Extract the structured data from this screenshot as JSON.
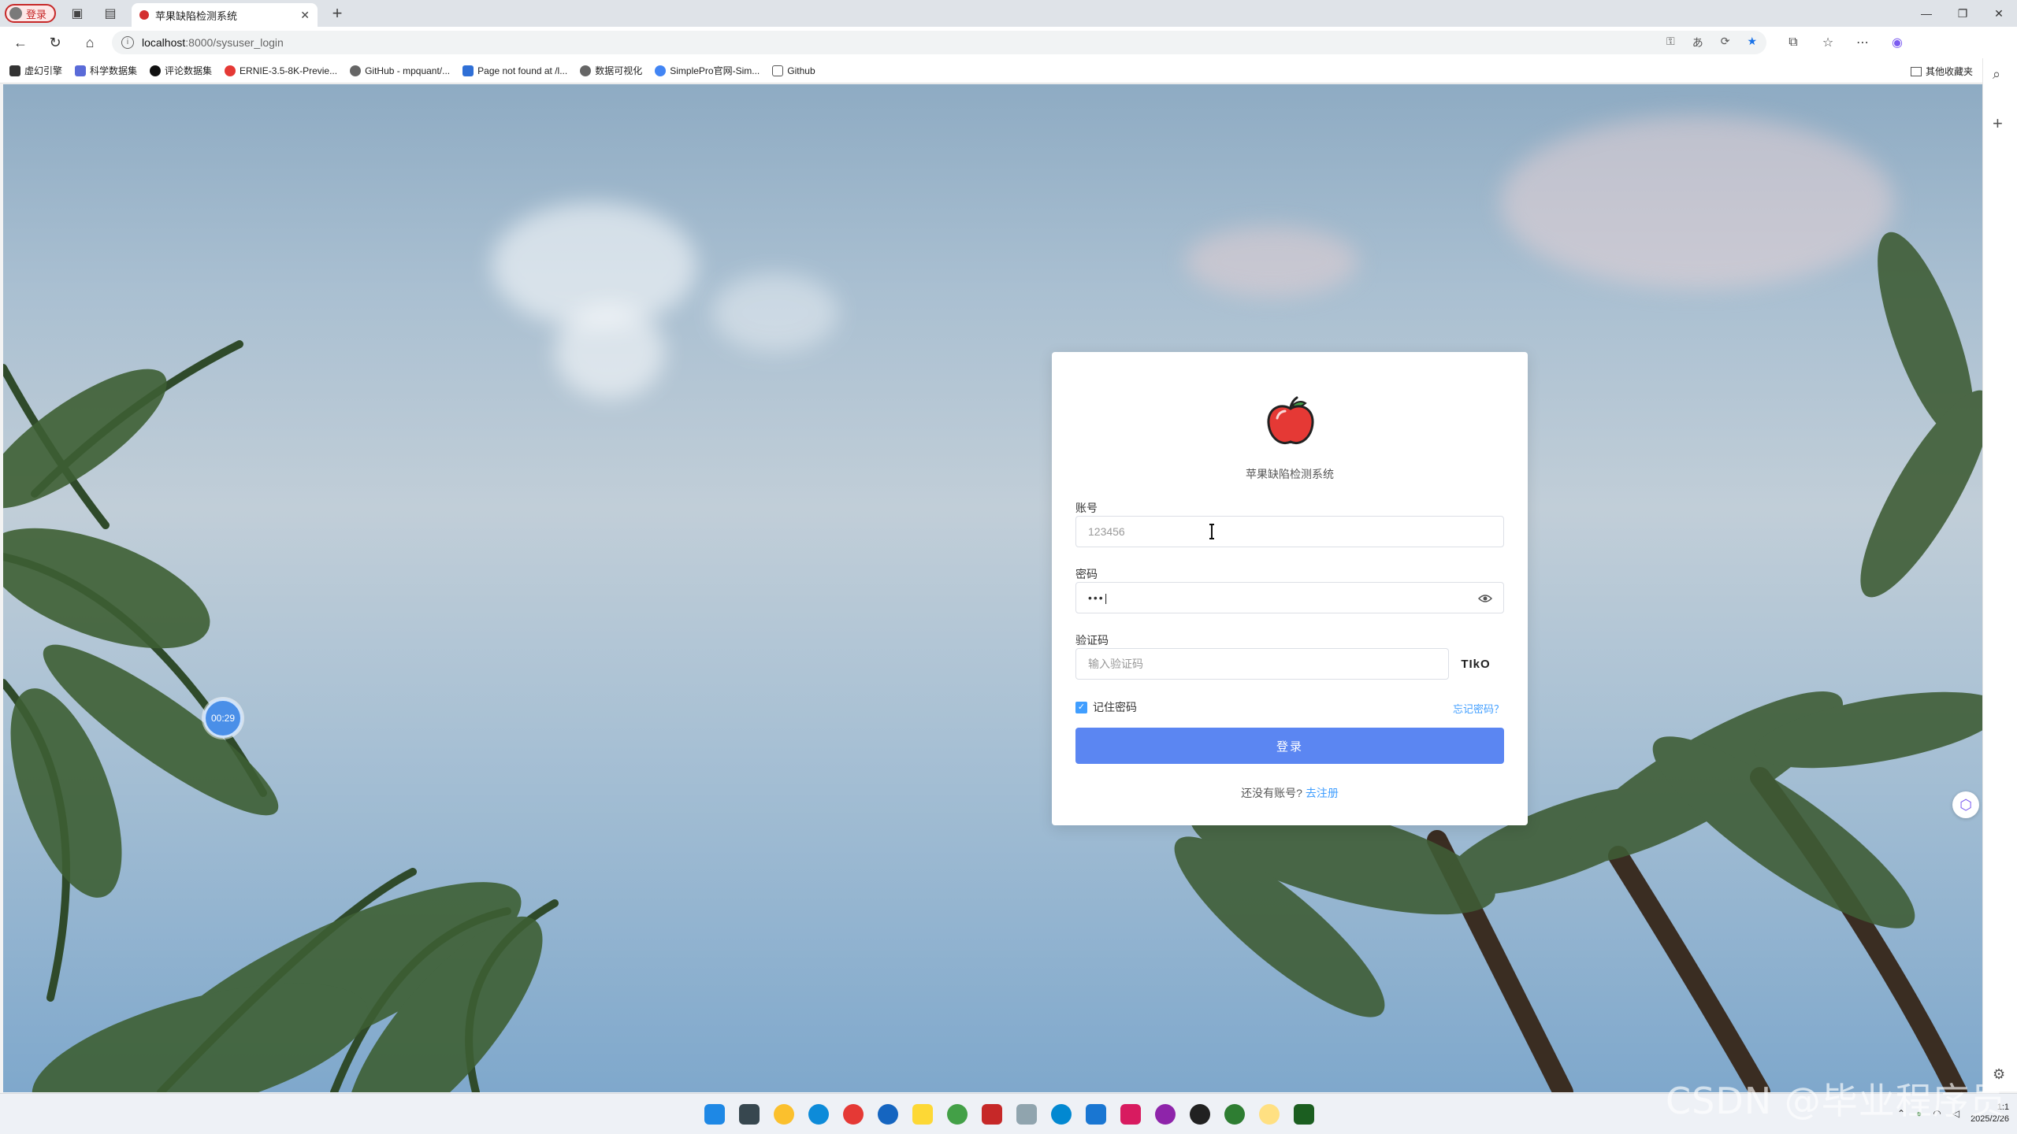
{
  "browser": {
    "profile_label": "登录",
    "tab_title": "苹果缺陷检测系统",
    "url_host": "localhost",
    "url_path": ":8000/sysuser_login",
    "bookmarks": [
      "虚幻引擎",
      "科学数据集",
      "评论数据集",
      "ERNIE-3.5-8K-Previe...",
      "GitHub - mpquant/...",
      "Page not found at /l...",
      "数据可视化",
      "SimplePro官网-Sim...",
      "Github"
    ],
    "other_bookmarks": "其他收藏夹"
  },
  "login": {
    "system_name": "苹果缺陷检测系统",
    "account_label": "账号",
    "account_value": "123456",
    "password_label": "密码",
    "password_value": "•••|",
    "captcha_label": "验证码",
    "captcha_placeholder": "输入验证码",
    "captcha_code": "TIkO",
    "remember_label": "记住密码",
    "forgot_label": "忘记密码？",
    "login_button": "登录",
    "no_account_text": "还没有账号?",
    "register_link": "去注册"
  },
  "overlay": {
    "timer": "00:29"
  },
  "taskbar": {
    "clock_time": "1:1",
    "clock_date": "2025/2/26"
  },
  "watermark": "CSDN @毕业程序员",
  "colors": {
    "accent": "#409eff",
    "login_button": "#5b86f2",
    "apple_red": "#e53935"
  }
}
